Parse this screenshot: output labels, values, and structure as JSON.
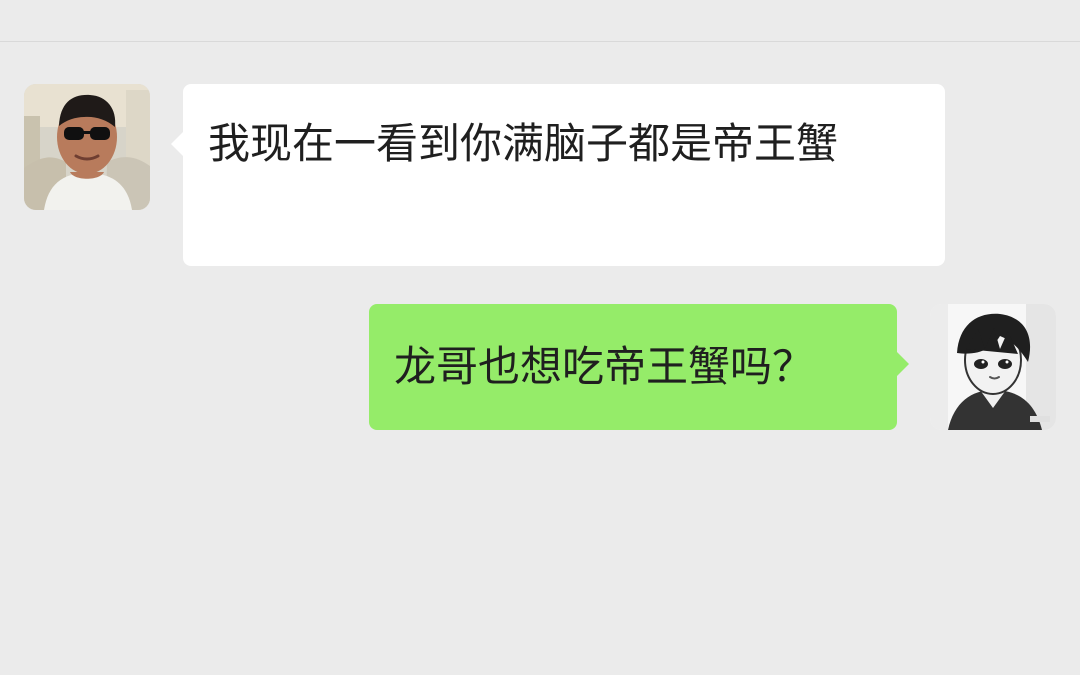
{
  "chat": {
    "messages": [
      {
        "sender": "contact",
        "text": "我现在一看到你满脑子都是帝王蟹",
        "avatar_icon": "contact-avatar-sunglasses-man"
      },
      {
        "sender": "self",
        "text": "龙哥也想吃帝王蟹吗？",
        "avatar_icon": "self-avatar-anime-boy"
      }
    ]
  },
  "colors": {
    "background": "#ebebeb",
    "received_bubble": "#ffffff",
    "sent_bubble": "#95ec69",
    "text": "#1f1f1f",
    "divider": "#d9d9d9"
  }
}
